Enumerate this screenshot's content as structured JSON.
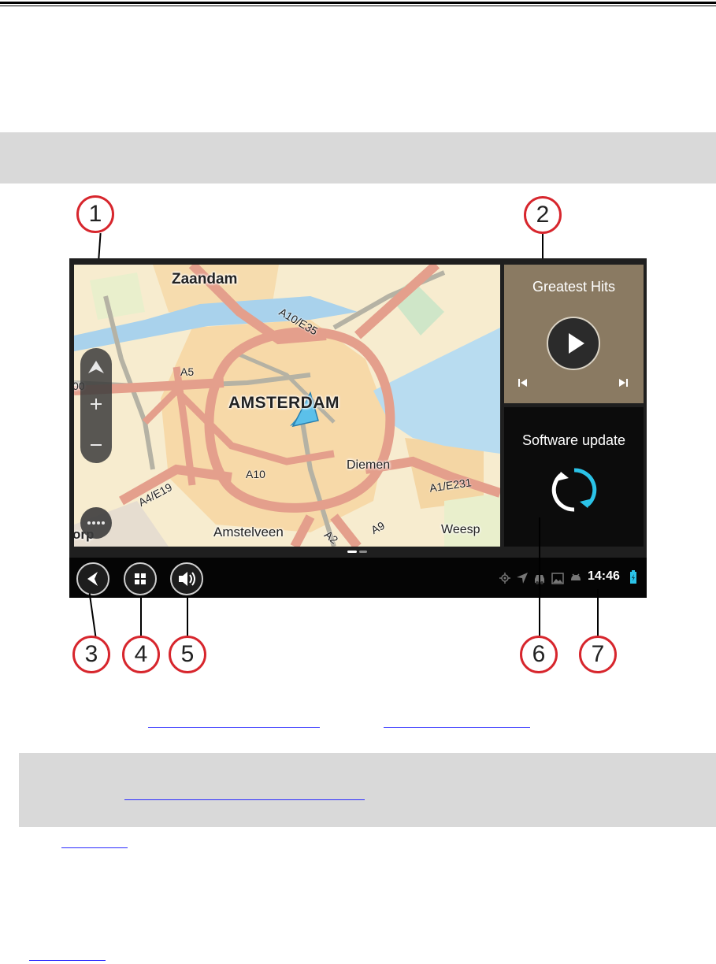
{
  "map": {
    "places": [
      "Zaandam",
      "AMSTERDAM",
      "Diemen",
      "Amstelveen",
      "Weesp"
    ],
    "partial_labels": [
      "00",
      "orp"
    ],
    "roads": [
      "A10/E35",
      "A5",
      "A10",
      "A4/E19",
      "A1/E231",
      "A9",
      "A2"
    ]
  },
  "music_panel": {
    "title": "Greatest Hits"
  },
  "update_panel": {
    "title": "Software update"
  },
  "status_bar": {
    "time": "14:46"
  },
  "callouts": [
    "1",
    "2",
    "3",
    "4",
    "5",
    "6",
    "7"
  ],
  "icons": {
    "map_controls": [
      "compass-icon",
      "zoom-in-icon",
      "zoom-out-icon",
      "more-icon"
    ],
    "music": [
      "play-icon",
      "previous-track-icon",
      "next-track-icon"
    ],
    "update": "refresh-icon",
    "navbar": [
      "back-icon",
      "apps-icon",
      "volume-icon"
    ],
    "status": [
      "location-icon",
      "navigation-icon",
      "car-icon",
      "image-icon",
      "android-icon",
      "battery-icon"
    ]
  },
  "colors": {
    "callout_ring": "#d7262d",
    "road": "#e49f8c",
    "water": "#b8dcf0",
    "refresh_accent": "#2bc3e8",
    "position_marker": "#4fb3de"
  }
}
